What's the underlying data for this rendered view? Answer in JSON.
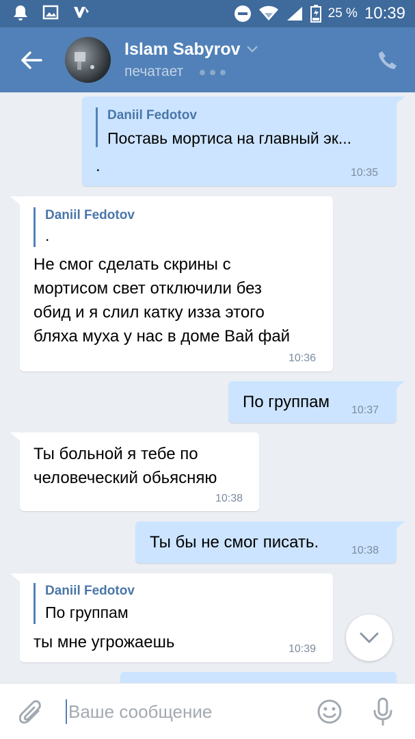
{
  "status_bar": {
    "battery": "25 %",
    "time": "10:39"
  },
  "header": {
    "contact_name": "Islam Sabyrov",
    "status": "печатает"
  },
  "messages": [
    {
      "direction": "out",
      "reply_author": "Daniil Fedotov",
      "reply_text": "Поставь мортиса на главный эк...",
      "text": ".",
      "time": "10:35"
    },
    {
      "direction": "in",
      "reply_author": "Daniil Fedotov",
      "reply_text": ".",
      "lines": [
        "Не смог сделать скрины с",
        "мортисом свет отключили без",
        "обид и я слил катку изза этого",
        "бляха муха у нас в доме Вай фай"
      ],
      "time": "10:36"
    },
    {
      "direction": "out",
      "text": "По группам",
      "time": "10:37"
    },
    {
      "direction": "in",
      "lines": [
        "Ты больной я тебе по",
        "человеческий обьясняю"
      ],
      "time": "10:38"
    },
    {
      "direction": "out",
      "text": "Ты бы не смог писать.",
      "time": "10:38"
    },
    {
      "direction": "in",
      "reply_author": "Daniil Fedotov",
      "reply_text": "По группам",
      "text": "ты мне угрожаешь",
      "time": "10:39"
    }
  ],
  "composer": {
    "placeholder": "Ваше сообщение"
  },
  "colors": {
    "status_bar": "#3e6a9c",
    "header": "#5181b8",
    "outgoing_bubble": "#cce4ff",
    "incoming_bubble": "#ffffff",
    "background": "#ebeff4",
    "accent": "#5181b8"
  },
  "icons": {
    "status_left": [
      "notification-bell-icon",
      "gallery-icon",
      "vk-icon"
    ],
    "status_right": [
      "do-not-disturb-icon",
      "wifi-icon",
      "signal-icon",
      "battery-icon"
    ],
    "header": [
      "back-arrow-icon",
      "chevron-down-icon",
      "phone-icon"
    ],
    "composer": [
      "attach-icon",
      "emoji-icon",
      "microphone-icon"
    ],
    "scroll": "chevron-down-icon"
  }
}
